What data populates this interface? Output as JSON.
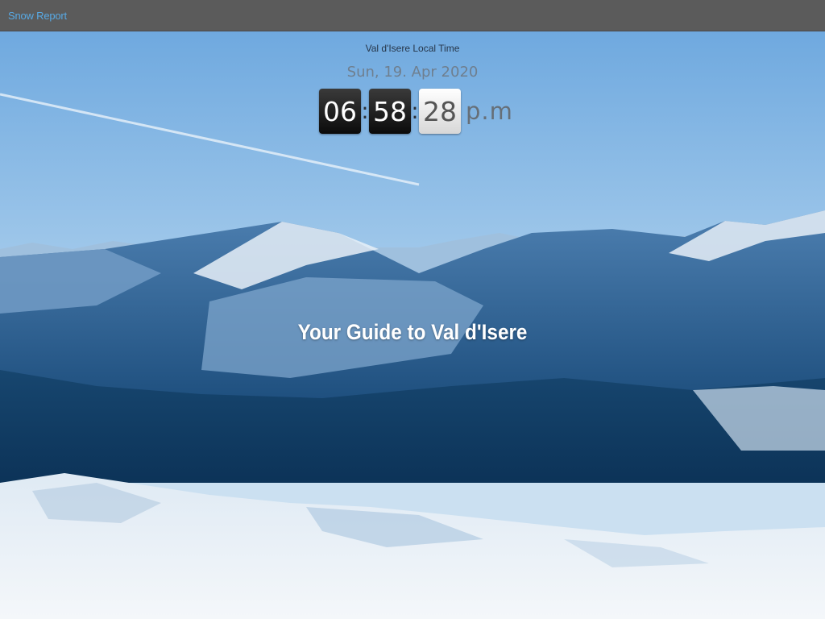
{
  "navbar": {
    "brand": "Snow Report"
  },
  "hero": {
    "local_time_label": "Val d'Isere Local Time",
    "date": "Sun, 19. Apr 2020",
    "clock": {
      "hours": "06",
      "minutes": "58",
      "seconds": "28",
      "separator": ":",
      "ampm": "p.m"
    },
    "headline": "Your Guide to Val d'Isere",
    "background_image": "snowy-mountain-range-photo"
  },
  "colors": {
    "navbar_bg": "#5b5b5b",
    "brand_link": "#58a9e4",
    "sky": "#8fbde6",
    "mountain_dark": "#0f3f6d"
  }
}
